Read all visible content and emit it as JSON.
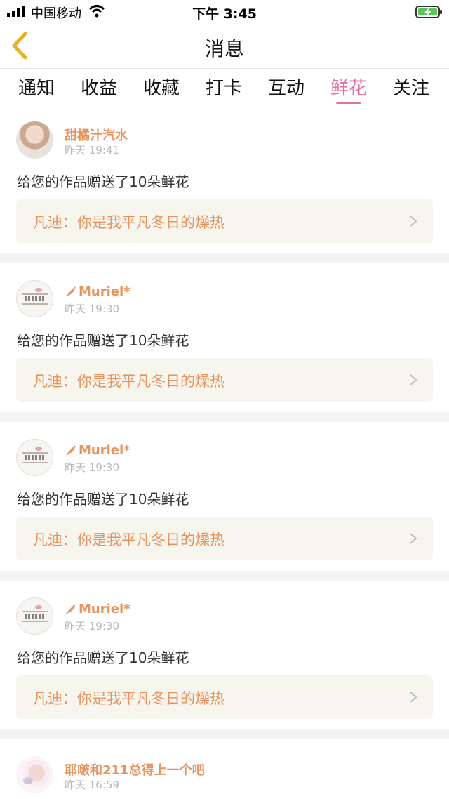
{
  "status_bar": {
    "carrier": "中国移动",
    "time": "下午 3:45"
  },
  "nav": {
    "title": "消息"
  },
  "tabs": [
    {
      "label": "通知",
      "active": false
    },
    {
      "label": "收益",
      "active": false
    },
    {
      "label": "收藏",
      "active": false
    },
    {
      "label": "打卡",
      "active": false
    },
    {
      "label": "互动",
      "active": false
    },
    {
      "label": "鲜花",
      "active": true
    },
    {
      "label": "关注",
      "active": false
    }
  ],
  "colors": {
    "accent": "#e86fa6",
    "username": "#e8935d",
    "quote_bg": "#f6f5ee"
  },
  "items": [
    {
      "username": "甜橘汁汽水",
      "time": "昨天 19:41",
      "message": "给您的作品赠送了10朵鲜花",
      "quote": "凡迪：你是我平凡冬日的燥热",
      "avatar": "photo-avatar"
    },
    {
      "username": "Muriel*",
      "time": "昨天 19:30",
      "message": "给您的作品赠送了10朵鲜花",
      "quote": "凡迪：你是我平凡冬日的燥热",
      "avatar": "note-avatar"
    },
    {
      "username": "Muriel*",
      "time": "昨天 19:30",
      "message": "给您的作品赠送了10朵鲜花",
      "quote": "凡迪：你是我平凡冬日的燥热",
      "avatar": "note-avatar"
    },
    {
      "username": "Muriel*",
      "time": "昨天 19:30",
      "message": "给您的作品赠送了10朵鲜花",
      "quote": "凡迪：你是我平凡冬日的燥热",
      "avatar": "note-avatar"
    },
    {
      "username": "耶啵和211总得上一个吧",
      "time": "昨天 16:59",
      "avatar": "kid-avatar"
    }
  ]
}
